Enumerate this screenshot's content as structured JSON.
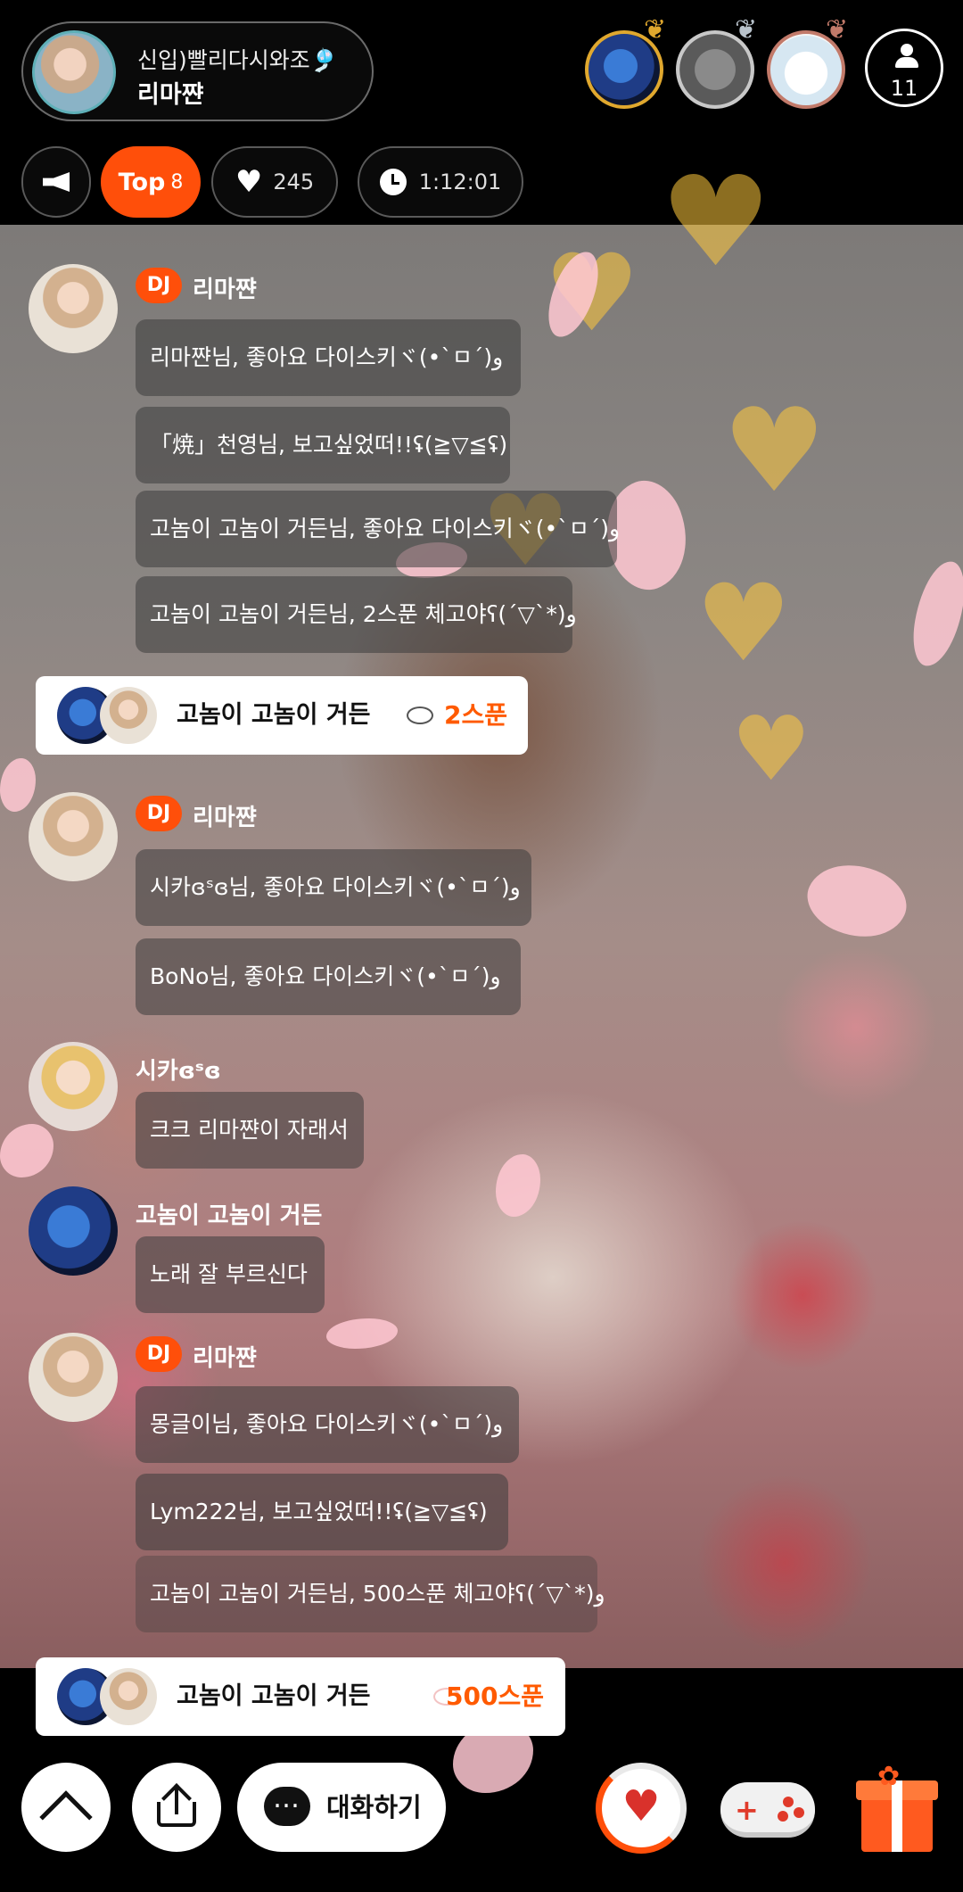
{
  "header": {
    "host_title": "신입)빨리다시와조🎐",
    "host_name": "리마쨘",
    "listener_count": "11"
  },
  "pills": {
    "top_label": "Top",
    "top_count": "8",
    "likes": "245",
    "timer": "1:12:01"
  },
  "chat": {
    "dj_badge": "DJ",
    "host_name": "리마쨘",
    "group1": [
      "리마쨘님, 좋아요 다이스키ヾ(•`ㅁ´)و",
      "「焼」천영님, 보고싶었떠!!ʢ(≧▽≦ʢ)",
      "고놈이 고놈이 거든님, 좋아요 다이스키ヾ(•`ㅁ´)و",
      "고놈이 고놈이 거든님, 2스푼 체고야ʕ(´▽`*)و"
    ],
    "gift1": {
      "sender": "고놈이 고놈이 거든",
      "amount": "2스푼"
    },
    "group2": [
      "시카ɞˢɞ님, 좋아요 다이스키ヾ(•`ㅁ´)و",
      "BoNo님, 좋아요 다이스키ヾ(•`ㅁ´)و"
    ],
    "user1": {
      "name": "시카ɞˢɞ",
      "message": "크크 리마쨘이 자래서"
    },
    "user2": {
      "name": "고놈이 고놈이 거든",
      "message": "노래 잘 부르신다"
    },
    "group3": [
      "몽글이님, 좋아요 다이스키ヾ(•`ㅁ´)و",
      "Lym222님, 보고싶었떠!!ʢ(≧▽≦ʢ)",
      "고놈이 고놈이 거든님, 500스푼 체고야ʕ(´▽`*)و"
    ],
    "gift2": {
      "sender": "고놈이 고놈이 거든",
      "amount": "500스푼"
    }
  },
  "bottom": {
    "chat_label": "대화하기",
    "like_icon": "heart-icon",
    "game_icon": "gamepad-icon",
    "gift_icon": "gift-icon"
  },
  "colors": {
    "accent": "#ff4f0a",
    "spoon": "#ff5a00"
  }
}
